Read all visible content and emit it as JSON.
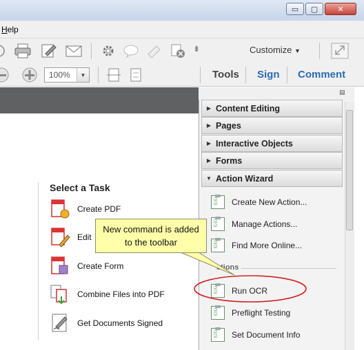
{
  "window": {
    "minimize": "▭",
    "maximize": "▢",
    "close": "✕"
  },
  "menu": {
    "help": "Help"
  },
  "toolbar": {
    "customize": "Customize",
    "zoom": "100%",
    "tools": "Tools",
    "sign": "Sign",
    "comment": "Comment"
  },
  "task_pane": {
    "title": "Select a Task",
    "items": [
      {
        "label": "Create PDF",
        "icon": "create-pdf-icon"
      },
      {
        "label": "Edit",
        "icon": "edit-pdf-icon"
      },
      {
        "label": "Create Form",
        "icon": "create-form-icon"
      },
      {
        "label": "Combine Files into PDF",
        "icon": "combine-files-icon"
      },
      {
        "label": "Get Documents Signed",
        "icon": "sign-documents-icon"
      }
    ]
  },
  "panel": {
    "sections": [
      {
        "label": "Content Editing",
        "expanded": false
      },
      {
        "label": "Pages",
        "expanded": false
      },
      {
        "label": "Interactive Objects",
        "expanded": false
      },
      {
        "label": "Forms",
        "expanded": false
      },
      {
        "label": "Action Wizard",
        "expanded": true
      }
    ],
    "wizard_items": [
      "Create New Action...",
      "Manage Actions...",
      "Find More Online..."
    ],
    "actions_label": "ctions",
    "actions": [
      "Run OCR",
      "Preflight Testing",
      "Set Document Info"
    ]
  },
  "callout": {
    "line1": "New command is added",
    "line2": "to the toolbar"
  },
  "colors": {
    "link_blue": "#2a6ab5",
    "highlight_red": "#d42020",
    "callout_bg": "#ffffaa"
  }
}
